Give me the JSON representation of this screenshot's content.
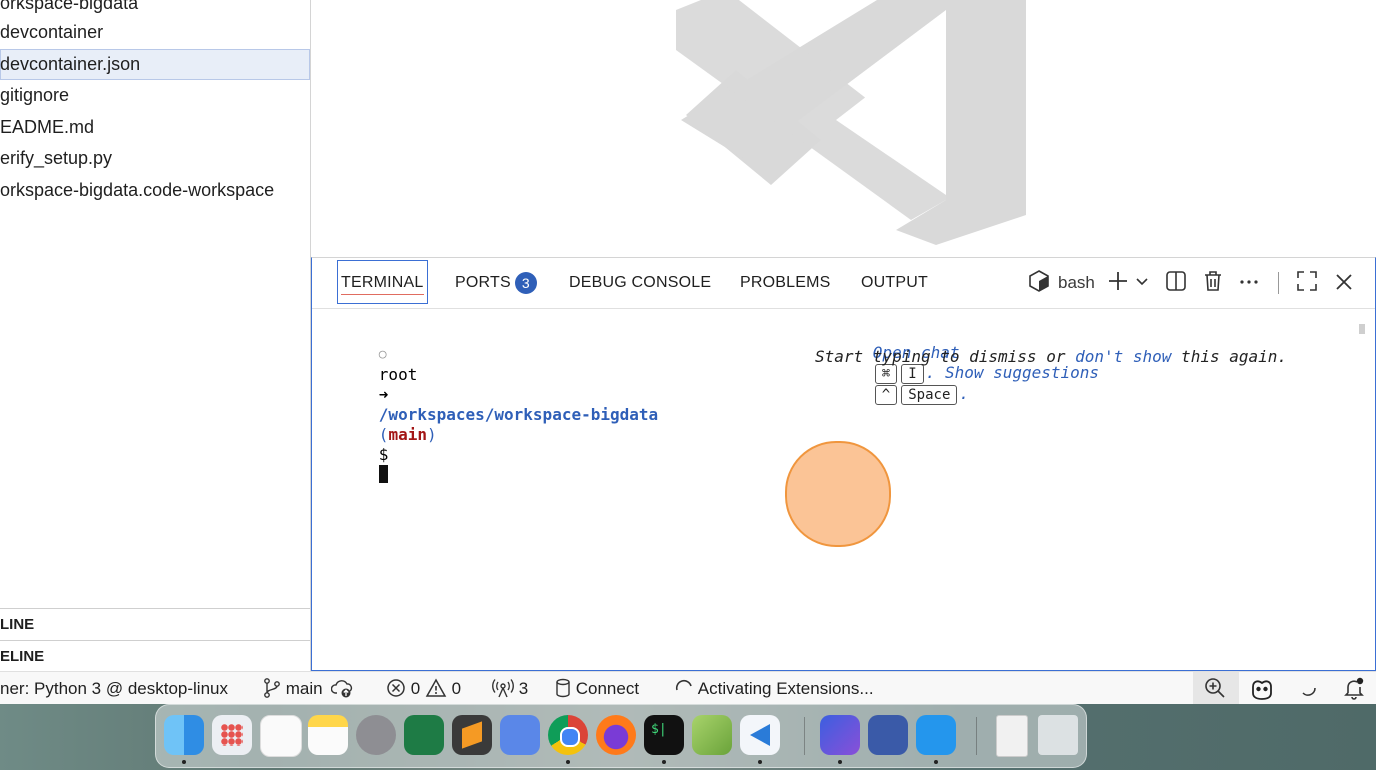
{
  "explorer": {
    "items": [
      {
        "label": "orkspace-bigdata",
        "selected": false
      },
      {
        "label": "devcontainer",
        "selected": false
      },
      {
        "label": "devcontainer.json",
        "selected": true
      },
      {
        "label": "gitignore",
        "selected": false
      },
      {
        "label": "EADME.md",
        "selected": false
      },
      {
        "label": "erify_setup.py",
        "selected": false
      },
      {
        "label": "orkspace-bigdata.code-workspace",
        "selected": false
      }
    ],
    "sections": [
      "LINE",
      "ELINE"
    ]
  },
  "panel": {
    "tabs": [
      {
        "label": "TERMINAL",
        "active": true
      },
      {
        "label": "PORTS",
        "badge": "3"
      },
      {
        "label": "DEBUG CONSOLE"
      },
      {
        "label": "PROBLEMS"
      },
      {
        "label": "OUTPUT"
      }
    ],
    "shell_label": "bash"
  },
  "terminal": {
    "user": "root",
    "arrow": "➜",
    "path": "/workspaces/workspace-bigdata",
    "branch_open": "(",
    "branch": "main",
    "branch_close": ")",
    "prompt": "$",
    "hint_open_chat": "Open chat",
    "key_cmd": "⌘",
    "key_i": "I",
    "hint_show_suggestions": ". Show suggestions",
    "key_ctrl": "^",
    "key_space": "Space",
    "hint_period": ".",
    "line2_start": "Start typing to dismiss or ",
    "line2_link": "don't show",
    "line2_end": " this again."
  },
  "statusbar": {
    "remote": "ner: Python 3 @ desktop-linux",
    "branch": "main",
    "errors": "0",
    "warnings": "0",
    "ports": "3",
    "connect": "Connect",
    "activity": "Activating Extensions..."
  },
  "colors": {
    "accent": "#3b6fd4",
    "badge": "#2f5fb8",
    "terminal_path": "#2f5fb8",
    "terminal_branch": "#a31515",
    "cursor_circle": "#fbc496"
  },
  "dock": {
    "apps": [
      "finder-icon",
      "launchpad-icon",
      "reminders-icon",
      "notes-icon",
      "settings-icon",
      "excel-icon",
      "sublime-icon",
      "network-icon",
      "chrome-icon",
      "firefox-icon",
      "terminal-icon",
      "textedit-icon",
      "vscode-icon",
      "sublime-merge-icon",
      "3d-cube-icon",
      "docker-icon",
      "file-icon",
      "trash-icon"
    ]
  }
}
